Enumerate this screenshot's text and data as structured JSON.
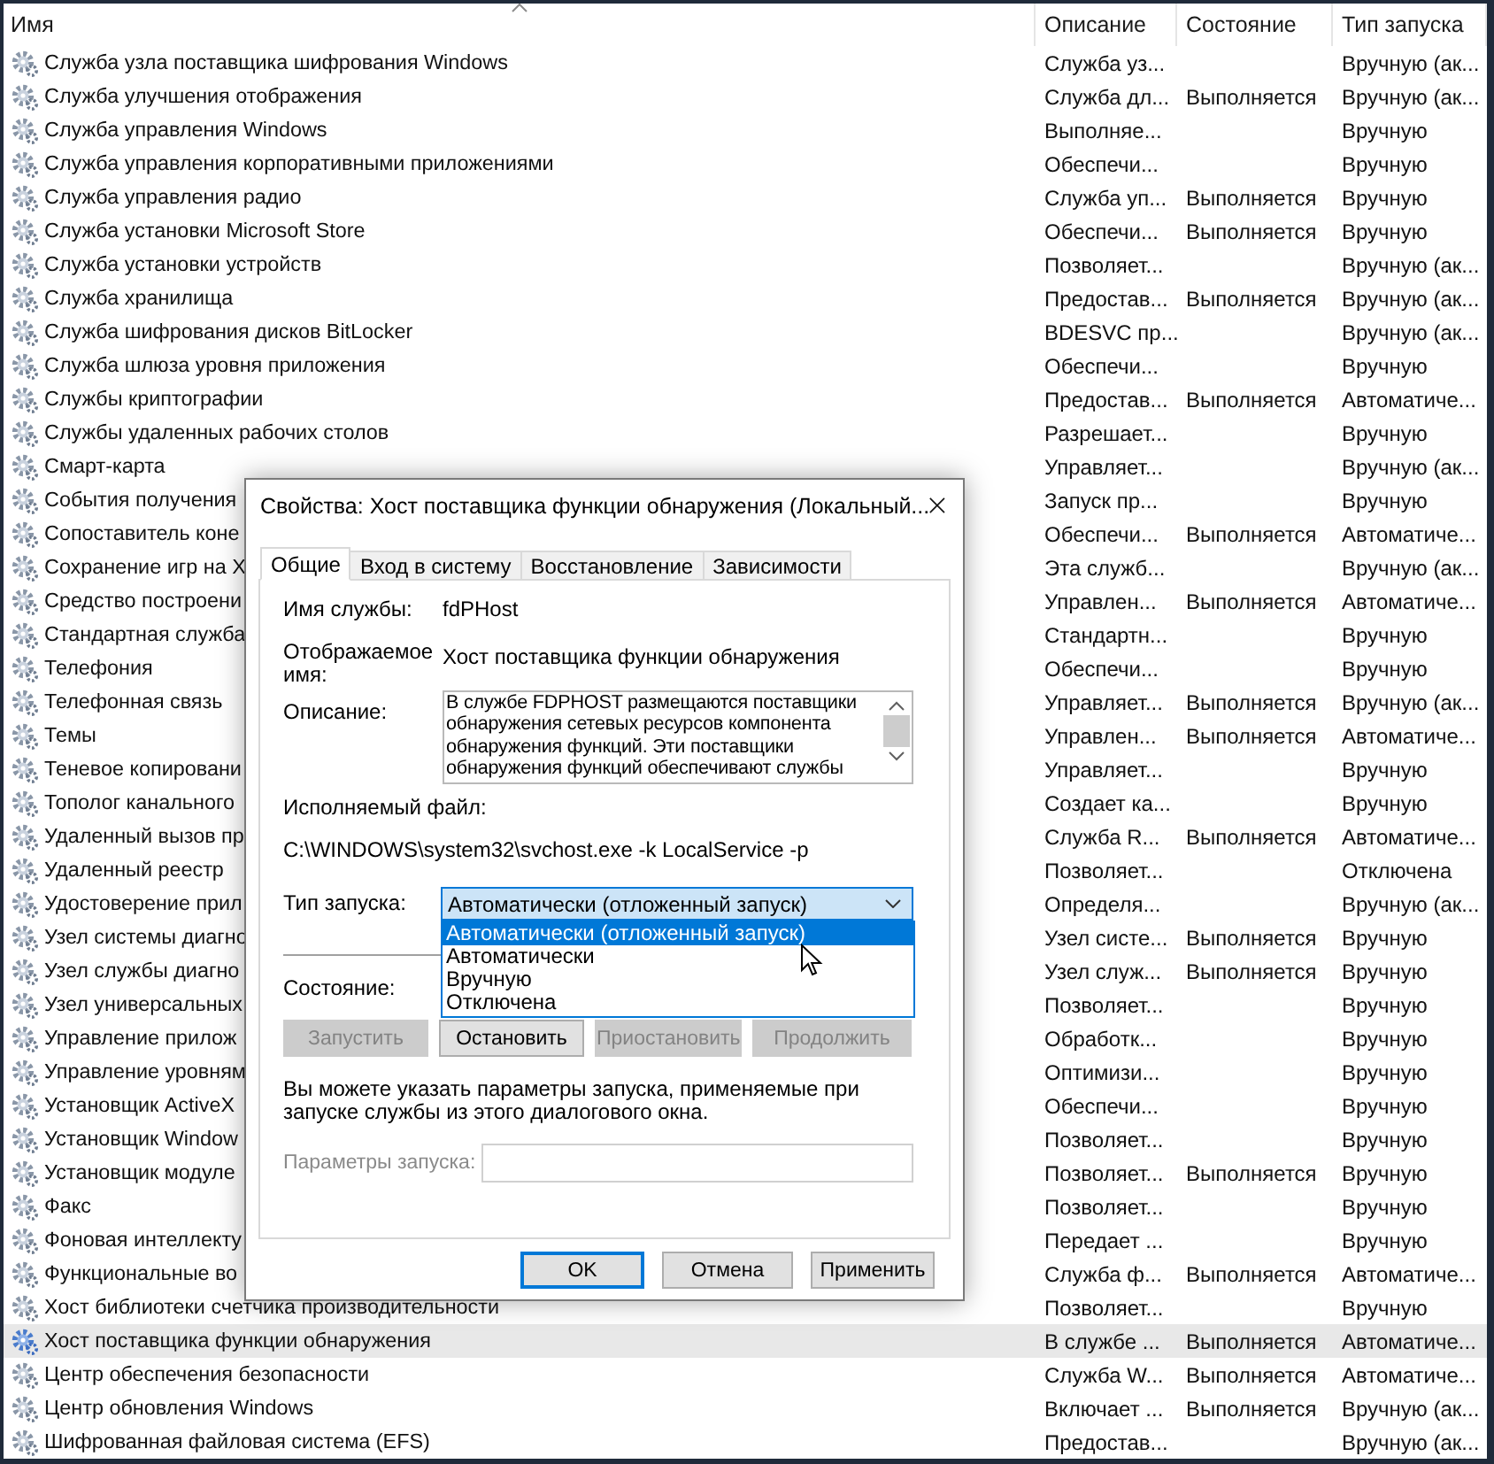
{
  "table": {
    "columns": [
      "Имя",
      "Описание",
      "Состояние",
      "Тип запуска"
    ],
    "rows": [
      {
        "name": "Служба узла поставщика шифрования Windows",
        "description": "Служба уз...",
        "status": "",
        "startup": "Вручную (ак...",
        "selected": false
      },
      {
        "name": "Служба улучшения отображения",
        "description": "Служба дл...",
        "status": "Выполняется",
        "startup": "Вручную (ак...",
        "selected": false
      },
      {
        "name": "Служба управления Windows",
        "description": "Выполняе...",
        "status": "",
        "startup": "Вручную",
        "selected": false
      },
      {
        "name": "Служба управления корпоративными приложениями",
        "description": "Обеспечи...",
        "status": "",
        "startup": "Вручную",
        "selected": false
      },
      {
        "name": "Служба управления радио",
        "description": "Служба уп...",
        "status": "Выполняется",
        "startup": "Вручную",
        "selected": false
      },
      {
        "name": "Служба установки Microsoft Store",
        "description": "Обеспечи...",
        "status": "Выполняется",
        "startup": "Вручную",
        "selected": false
      },
      {
        "name": "Служба установки устройств",
        "description": "Позволяет...",
        "status": "",
        "startup": "Вручную (ак...",
        "selected": false
      },
      {
        "name": "Служба хранилища",
        "description": "Предостав...",
        "status": "Выполняется",
        "startup": "Вручную (ак...",
        "selected": false
      },
      {
        "name": "Служба шифрования дисков BitLocker",
        "description": "BDESVC пр...",
        "status": "",
        "startup": "Вручную (ак...",
        "selected": false
      },
      {
        "name": "Служба шлюза уровня приложения",
        "description": "Обеспечи...",
        "status": "",
        "startup": "Вручную",
        "selected": false
      },
      {
        "name": "Службы криптографии",
        "description": "Предостав...",
        "status": "Выполняется",
        "startup": "Автоматиче...",
        "selected": false
      },
      {
        "name": "Службы удаленных рабочих столов",
        "description": "Разрешает...",
        "status": "",
        "startup": "Вручную",
        "selected": false
      },
      {
        "name": "Смарт-карта",
        "description": "Управляет...",
        "status": "",
        "startup": "Вручную (ак...",
        "selected": false
      },
      {
        "name": "События получения",
        "description": "Запуск пр...",
        "status": "",
        "startup": "Вручную",
        "selected": false
      },
      {
        "name": "Сопоставитель коне",
        "description": "Обеспечи...",
        "status": "Выполняется",
        "startup": "Автоматиче...",
        "selected": false
      },
      {
        "name": "Сохранение игр на X",
        "description": "Эта служб...",
        "status": "",
        "startup": "Вручную (ак...",
        "selected": false
      },
      {
        "name": "Средство построени",
        "description": "Управлен...",
        "status": "Выполняется",
        "startup": "Автоматиче...",
        "selected": false
      },
      {
        "name": "Стандартная служба",
        "description": "Стандартн...",
        "status": "",
        "startup": "Вручную",
        "selected": false
      },
      {
        "name": "Телефония",
        "description": "Обеспечи...",
        "status": "",
        "startup": "Вручную",
        "selected": false
      },
      {
        "name": "Телефонная связь",
        "description": "Управляет...",
        "status": "Выполняется",
        "startup": "Вручную (ак...",
        "selected": false
      },
      {
        "name": "Темы",
        "description": "Управлен...",
        "status": "Выполняется",
        "startup": "Автоматиче...",
        "selected": false
      },
      {
        "name": "Теневое копировани",
        "description": "Управляет...",
        "status": "",
        "startup": "Вручную",
        "selected": false
      },
      {
        "name": "Тополог канального",
        "description": "Создает ка...",
        "status": "",
        "startup": "Вручную",
        "selected": false
      },
      {
        "name": "Удаленный вызов пр",
        "description": "Служба R...",
        "status": "Выполняется",
        "startup": "Автоматиче...",
        "selected": false
      },
      {
        "name": "Удаленный реестр",
        "description": "Позволяет...",
        "status": "",
        "startup": "Отключена",
        "selected": false
      },
      {
        "name": "Удостоверение прил",
        "description": "Определя...",
        "status": "",
        "startup": "Вручную (ак...",
        "selected": false
      },
      {
        "name": "Узел системы диагно",
        "description": "Узел систе...",
        "status": "Выполняется",
        "startup": "Вручную",
        "selected": false
      },
      {
        "name": "Узел службы диагно",
        "description": "Узел служ...",
        "status": "Выполняется",
        "startup": "Вручную",
        "selected": false
      },
      {
        "name": "Узел универсальных",
        "description": "Позволяет...",
        "status": "",
        "startup": "Вручную",
        "selected": false
      },
      {
        "name": "Управление прилож",
        "description": "Обработк...",
        "status": "",
        "startup": "Вручную",
        "selected": false
      },
      {
        "name": "Управление уровням",
        "description": "Оптимизи...",
        "status": "",
        "startup": "Вручную",
        "selected": false
      },
      {
        "name": "Установщик ActiveX",
        "description": "Обеспечи...",
        "status": "",
        "startup": "Вручную",
        "selected": false
      },
      {
        "name": "Установщик Window",
        "description": "Позволяет...",
        "status": "",
        "startup": "Вручную",
        "selected": false
      },
      {
        "name": "Установщик модуле",
        "description": "Позволяет...",
        "status": "Выполняется",
        "startup": "Вручную",
        "selected": false
      },
      {
        "name": "Факс",
        "description": "Позволяет...",
        "status": "",
        "startup": "Вручную",
        "selected": false
      },
      {
        "name": "Фоновая интеллекту",
        "description": "Передает ...",
        "status": "",
        "startup": "Вручную",
        "selected": false
      },
      {
        "name": "Функциональные во",
        "description": "Служба ф...",
        "status": "Выполняется",
        "startup": "Автоматиче...",
        "selected": false
      },
      {
        "name": "Хост библиотеки счетчика производительности",
        "description": "Позволяет...",
        "status": "",
        "startup": "Вручную",
        "selected": false
      },
      {
        "name": "Хост поставщика функции обнаружения",
        "description": "В службе ...",
        "status": "Выполняется",
        "startup": "Автоматиче...",
        "selected": true
      },
      {
        "name": "Центр обеспечения безопасности",
        "description": "Служба W...",
        "status": "Выполняется",
        "startup": "Автоматиче...",
        "selected": false
      },
      {
        "name": "Центр обновления Windows",
        "description": "Включает ...",
        "status": "Выполняется",
        "startup": "Вручную (ак...",
        "selected": false
      },
      {
        "name": "Шифрованная файловая система (EFS)",
        "description": "Предостав...",
        "status": "",
        "startup": "Вручную (ак...",
        "selected": false
      }
    ]
  },
  "dialog": {
    "title": "Свойства: Хост поставщика функции обнаружения (Локальный...",
    "tabs": [
      {
        "label": "Общие",
        "selected": true
      },
      {
        "label": "Вход в систему",
        "selected": false
      },
      {
        "label": "Восстановление",
        "selected": false
      },
      {
        "label": "Зависимости",
        "selected": false
      }
    ],
    "service_name_label": "Имя службы:",
    "service_name": "fdPHost",
    "display_name_label": "Отображаемое имя:",
    "display_name": "Хост поставщика функции обнаружения",
    "description_label": "Описание:",
    "description": "В службе FDPHOST размещаются поставщики обнаружения сетевых ресурсов компонента обнаружения функций. Эти поставщики обнаружения функций обеспечивают службы",
    "executable_label": "Исполняемый файл:",
    "executable_path": "C:\\WINDOWS\\system32\\svchost.exe -k LocalService -p",
    "startup_type_label": "Тип запуска:",
    "startup_type": {
      "value": "Автоматически (отложенный запуск)",
      "expanded": true,
      "options": [
        {
          "label": "Автоматически (отложенный запуск)",
          "selected": true
        },
        {
          "label": "Автоматически",
          "selected": false
        },
        {
          "label": "Вручную",
          "selected": false
        },
        {
          "label": "Отключена",
          "selected": false
        }
      ]
    },
    "status_label": "Состояние:",
    "control_buttons": [
      {
        "label": "Запустить",
        "disabled": true
      },
      {
        "label": "Остановить",
        "disabled": false
      },
      {
        "label": "Приостановить",
        "disabled": true
      },
      {
        "label": "Продолжить",
        "disabled": true
      }
    ],
    "hint": "Вы можете указать параметры запуска, применяемые при запуске службы из этого диалогового окна.",
    "start_params": {
      "label": "Параметры запуска:",
      "disabled": true
    },
    "buttons": [
      {
        "label": "OK",
        "default": true
      },
      {
        "label": "Отмена",
        "default": false
      },
      {
        "label": "Применить",
        "default": false
      }
    ]
  }
}
